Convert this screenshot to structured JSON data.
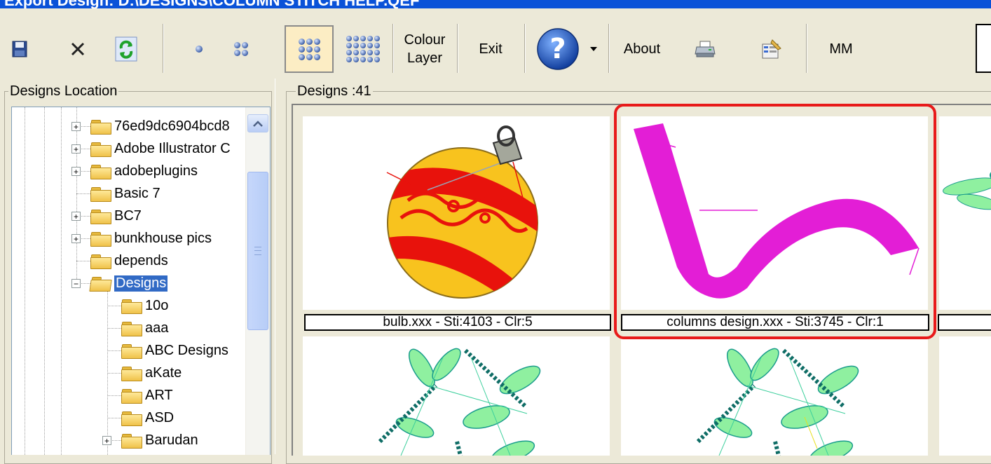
{
  "window": {
    "title": "Export Design: D:\\DESIGNS\\COLUMN STITCH HELP.QEF"
  },
  "toolbar": {
    "save_icon": "floppy-disk-icon",
    "close_icon": "x-icon",
    "refresh_icon": "refresh-icon",
    "colour_layer_line1": "Colour",
    "colour_layer_line2": "Layer",
    "exit_label": "Exit",
    "help_icon": "question-mark-icon",
    "help_dropdown_icon": "triangle-down-icon",
    "about_label": "About",
    "print_icon": "printer-icon",
    "properties_icon": "properties-icon",
    "units_label": "MM",
    "thumbnail_sizes": [
      "1x1",
      "2x2",
      "3x3",
      "4x4"
    ],
    "selected_size": "3x3"
  },
  "left_panel": {
    "legend": "Designs Location",
    "tree": [
      {
        "label": "76ed9dc6904bcd8",
        "expandable": true,
        "depth": 0
      },
      {
        "label": "Adobe Illustrator C",
        "expandable": true,
        "depth": 0
      },
      {
        "label": "adobeplugins",
        "expandable": true,
        "depth": 0
      },
      {
        "label": "Basic 7",
        "expandable": false,
        "depth": 0
      },
      {
        "label": "BC7",
        "expandable": true,
        "depth": 0
      },
      {
        "label": "bunkhouse pics",
        "expandable": true,
        "depth": 0
      },
      {
        "label": "depends",
        "expandable": false,
        "depth": 0
      },
      {
        "label": "Designs",
        "expandable": true,
        "expanded": true,
        "selected": true,
        "depth": 0
      },
      {
        "label": "10o",
        "expandable": false,
        "depth": 1
      },
      {
        "label": "aaa",
        "expandable": false,
        "depth": 1
      },
      {
        "label": "ABC Designs",
        "expandable": false,
        "depth": 1
      },
      {
        "label": "aKate",
        "expandable": false,
        "depth": 1
      },
      {
        "label": "ART",
        "expandable": false,
        "depth": 1
      },
      {
        "label": "ASD",
        "expandable": false,
        "depth": 1
      },
      {
        "label": "Barudan",
        "expandable": true,
        "depth": 1
      }
    ]
  },
  "right_panel": {
    "legend": "Designs :41",
    "designs": [
      {
        "caption": "bulb.xxx - Sti:4103 - Clr:5",
        "highlighted": false
      },
      {
        "caption": "columns design.xxx - Sti:3745 - Clr:1",
        "highlighted": true
      }
    ]
  },
  "colors": {
    "accent_highlight": "#e81a1a",
    "selection": "#316ac5",
    "pressed_button": "#fcedc4",
    "design_magenta": "#e31ed6",
    "bulb_yellow": "#f8c31e",
    "bulb_red": "#e8120c",
    "dragonfly_teal": "#1a9c8c",
    "dragonfly_lightgreen": "#8ff0a0"
  }
}
